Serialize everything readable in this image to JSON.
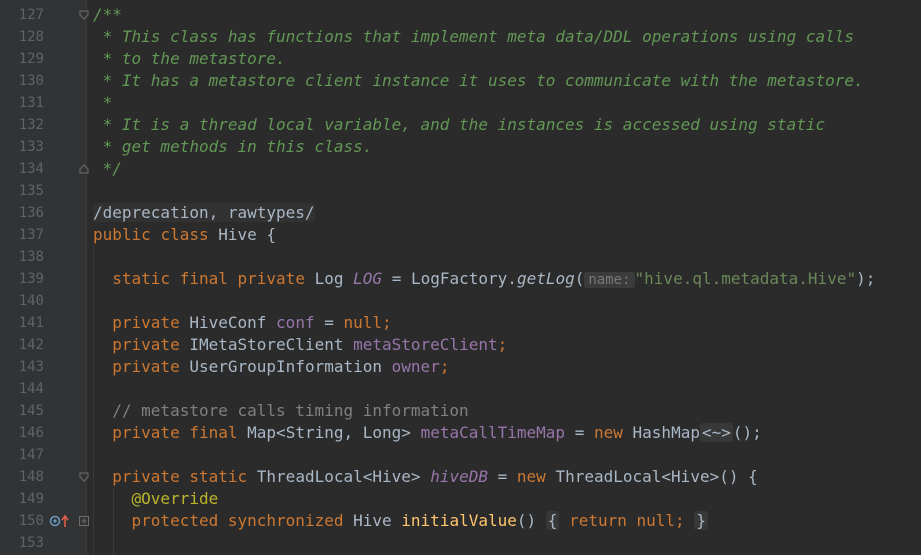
{
  "editor": {
    "line_numbers": [
      "127",
      "128",
      "129",
      "130",
      "131",
      "132",
      "133",
      "134",
      "135",
      "136",
      "137",
      "138",
      "139",
      "140",
      "141",
      "142",
      "143",
      "144",
      "145",
      "146",
      "147",
      "148",
      "149",
      "150",
      "153"
    ],
    "code": {
      "l127_open": "/**",
      "l128": " * This class has functions that implement meta data/DDL operations using calls",
      "l129": " * to the metastore.",
      "l130": " * It has a metastore client instance it uses to communicate with the metastore.",
      "l131": " *",
      "l132": " * It is a thread local variable, and the instances is accessed using static",
      "l133": " * get methods in this class.",
      "l134": " */",
      "l136": "/deprecation, rawtypes/",
      "kw_public": "public",
      "kw_class": "class",
      "class_name": "Hive",
      "brace_open": "{",
      "kw_static": "static",
      "kw_final": "final",
      "kw_private": "private",
      "type_log": "Log",
      "field_log": "LOG",
      "eq": "=",
      "log_factory": "LogFactory.",
      "get_log": "getLog",
      "paren_open": "(",
      "param_hint": "name:",
      "log_string": "\"hive.ql.metadata.Hive\"",
      "paren_close_semi": ");",
      "type_hiveconf": "HiveConf",
      "field_conf": "conf",
      "kw_null": "null",
      "semi": ";",
      "type_imsc": "IMetaStoreClient",
      "field_msc": "metaStoreClient",
      "type_ugi": "UserGroupInformation",
      "field_owner": "owner",
      "line_comment": "// metastore calls timing information",
      "type_map": "Map<String, Long>",
      "field_timemap": "metaCallTimeMap",
      "kw_new": "new",
      "type_hashmap": "HashMap",
      "diamond": "<~>",
      "call_end": "();",
      "type_tl_hive": "ThreadLocal<Hive>",
      "field_hivedb": "hiveDB",
      "new_tl_end": "() {",
      "annotation": "@Override",
      "kw_protected": "protected",
      "kw_synchronized": "synchronized",
      "method_initial": "initialValue",
      "parens": "()",
      "kw_return": "return",
      "brace_close": "}"
    }
  },
  "colors": {
    "background": "#2b2b2b",
    "gutter": "#313335",
    "keyword": "#cc7832",
    "doc_comment": "#629755",
    "line_comment": "#808080",
    "string": "#6a8759",
    "field": "#9876aa",
    "method": "#ffc66d",
    "annotation": "#bbb529",
    "plain": "#a9b7c6"
  },
  "icons": [
    "fold-marker-icon",
    "override-marker-icon",
    "implements-arrow-icon"
  ]
}
